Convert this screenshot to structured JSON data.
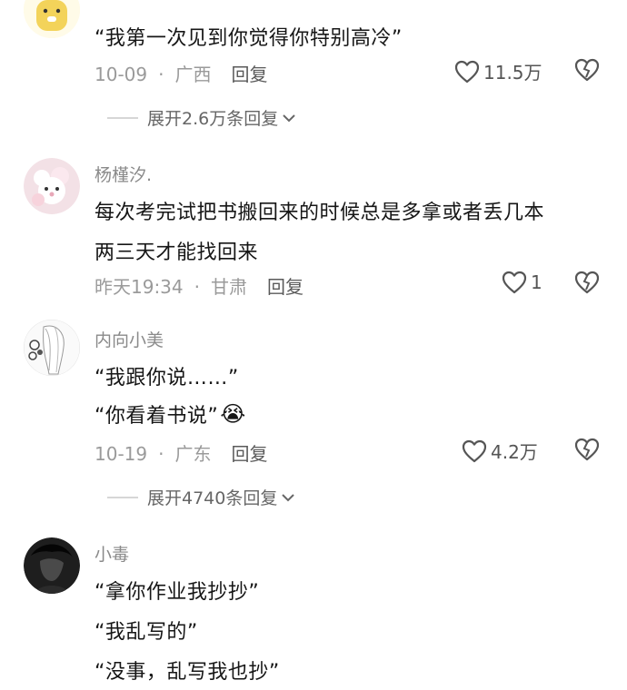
{
  "comments": [
    {
      "username": "",
      "lines": [
        "“我第一次见到你觉得你特别高冷”"
      ],
      "date": "10-09",
      "location": "广西",
      "reply_label": "回复",
      "likes": "11.5万",
      "expand": "展开2.6万条回复"
    },
    {
      "username": "杨槿汐.",
      "lines": [
        "每次考完试把书搬回来的时候总是多拿或者丢几本",
        "两三天才能找回来"
      ],
      "date": "昨天19:34",
      "location": "甘肃",
      "reply_label": "回复",
      "likes": "1"
    },
    {
      "username": "内向小美",
      "lines": [
        "“我跟你说……”",
        "“你看着书说”"
      ],
      "date": "10-19",
      "location": "广东",
      "reply_label": "回复",
      "likes": "4.2万",
      "expand": "展开4740条回复"
    },
    {
      "username": "小毒",
      "lines": [
        "“拿你作业我抄抄”",
        "“我乱写的”",
        "“没事，乱写我也抄”"
      ]
    }
  ],
  "separator": "·",
  "emoji": "😭"
}
